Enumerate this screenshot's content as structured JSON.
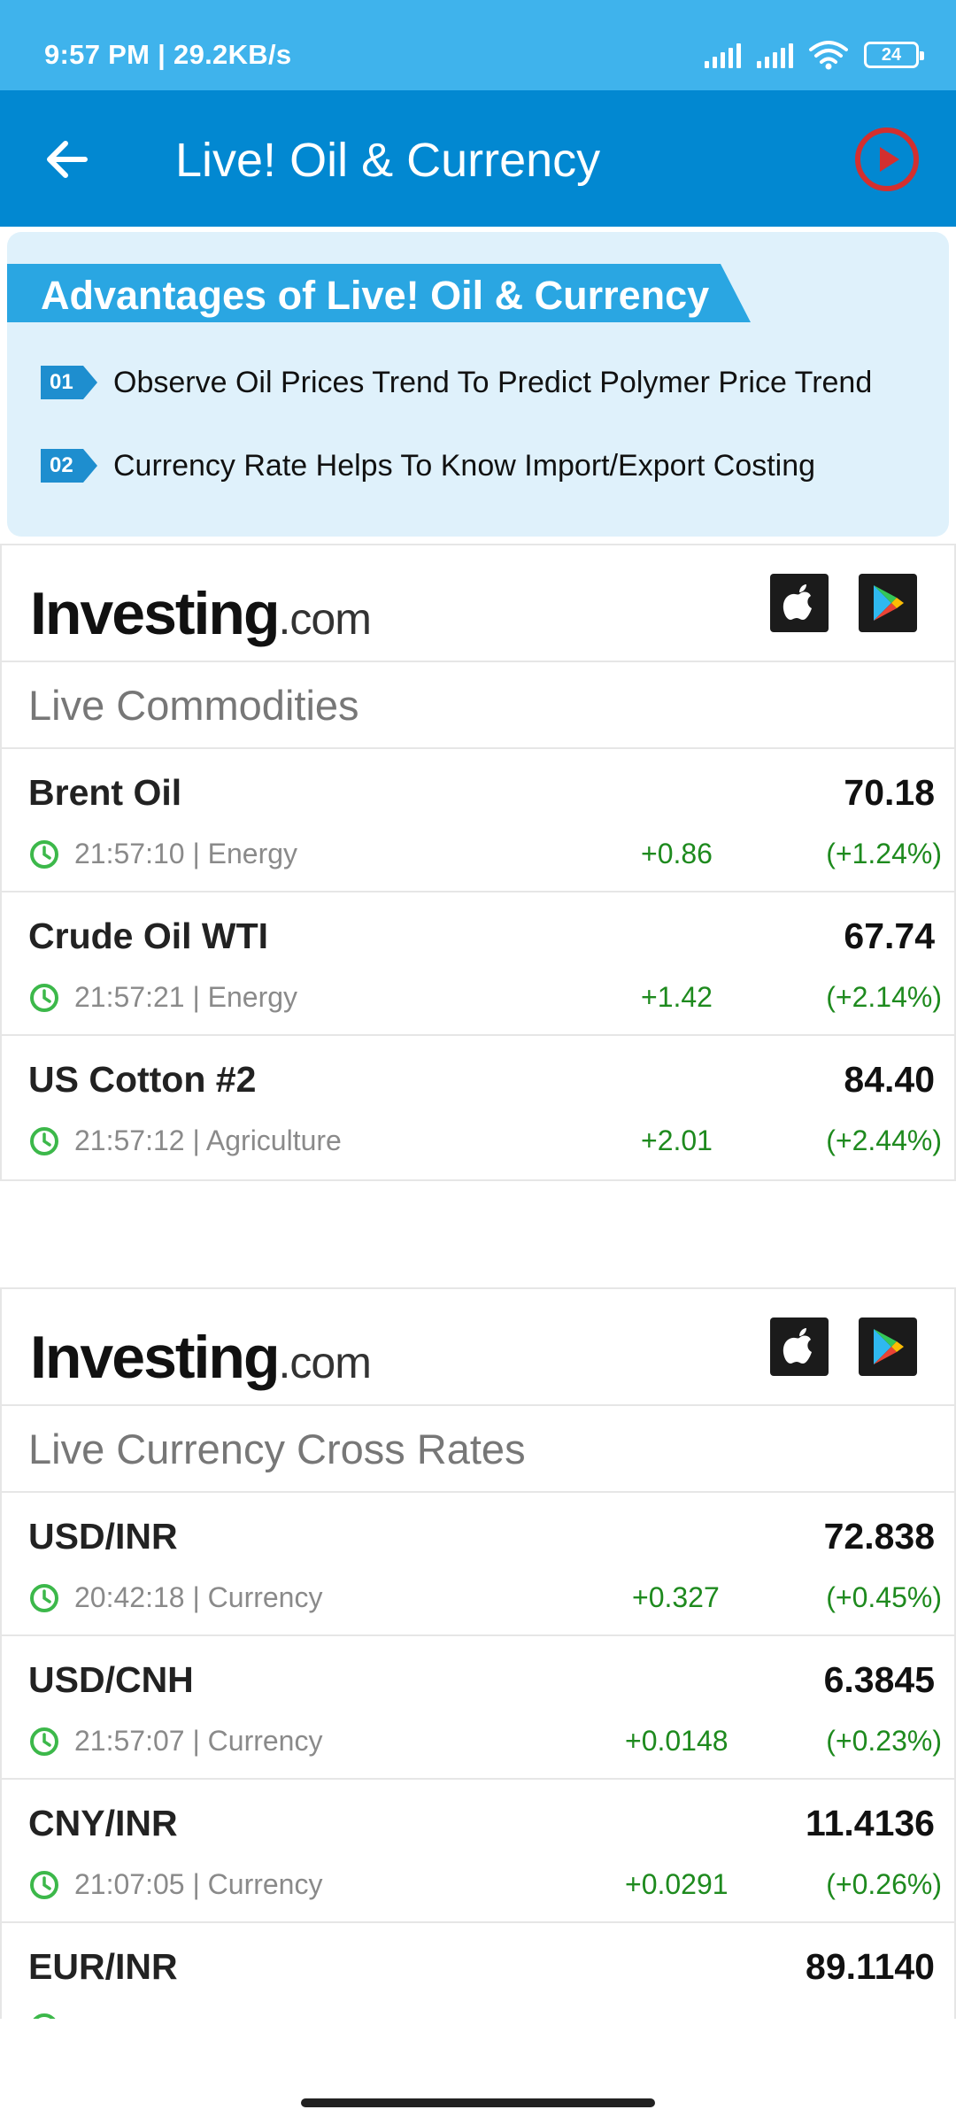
{
  "status_bar": {
    "time_speed": "9:57 PM | 29.2KB/s",
    "battery": "24"
  },
  "app_bar": {
    "title": "Live! Oil & Currency",
    "back_icon": "arrow-left-icon",
    "play_icon": "play-circle-icon"
  },
  "advantages": {
    "title": "Advantages of Live! Oil & Currency",
    "items": [
      {
        "num": "01",
        "text": "Observe Oil Prices Trend To Predict Polymer Price Trend"
      },
      {
        "num": "02",
        "text": "Currency Rate Helps To Know Import/Export Costing"
      }
    ]
  },
  "commodities": {
    "logo_main": "Investing",
    "logo_suffix": ".com",
    "title": "Live Commodities",
    "rows": [
      {
        "name": "Brent Oil",
        "price": "70.18",
        "time": "21:57:10 | Energy",
        "change": "+0.86",
        "pct": "(+1.24%)"
      },
      {
        "name": "Crude Oil WTI",
        "price": "67.74",
        "time": "21:57:21 | Energy",
        "change": "+1.42",
        "pct": "(+2.14%)"
      },
      {
        "name": "US Cotton #2",
        "price": "84.40",
        "time": "21:57:12 | Agriculture",
        "change": "+2.01",
        "pct": "(+2.44%)"
      }
    ]
  },
  "currencies": {
    "logo_main": "Investing",
    "logo_suffix": ".com",
    "title": "Live Currency Cross Rates",
    "rows": [
      {
        "name": "USD/INR",
        "price": "72.838",
        "time": "20:42:18 | Currency",
        "change": "+0.327",
        "pct": "(+0.45%)"
      },
      {
        "name": "USD/CNH",
        "price": "6.3845",
        "time": "21:57:07 | Currency",
        "change": "+0.0148",
        "pct": "(+0.23%)"
      },
      {
        "name": "CNY/INR",
        "price": "11.4136",
        "time": "21:07:05 | Currency",
        "change": "+0.0291",
        "pct": "(+0.26%)"
      },
      {
        "name": "EUR/INR",
        "price": "89.1140"
      }
    ]
  },
  "colors": {
    "status_bar": "#3fb3ec",
    "app_bar": "#0288d1",
    "panel_bg": "#dff1fb",
    "positive": "#1e8a1e",
    "play_accent": "#d32f2f"
  }
}
